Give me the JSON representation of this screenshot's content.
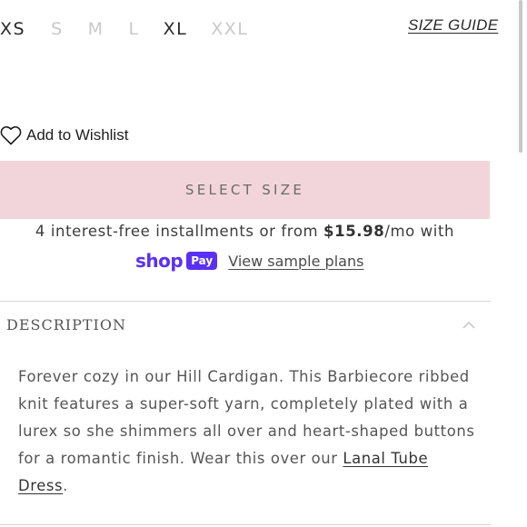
{
  "sizes": [
    {
      "label": "XS",
      "available": true
    },
    {
      "label": "S",
      "available": false
    },
    {
      "label": "M",
      "available": false
    },
    {
      "label": "L",
      "available": false
    },
    {
      "label": "XL",
      "available": true
    },
    {
      "label": "XXL",
      "available": false
    }
  ],
  "size_guide_label": "SIZE GUIDE",
  "wishlist": {
    "label": "Add to Wishlist",
    "icon": "heart-outline-icon"
  },
  "select_size_button": "SELECT SIZE",
  "installments": {
    "prefix": "4 interest-free installments or from ",
    "price": "$15.98",
    "suffix": "/mo with",
    "shop_word": "shop",
    "pay_badge": "Pay",
    "link": "View sample plans"
  },
  "description": {
    "title": "DESCRIPTION",
    "expanded": true,
    "text": "Forever cozy in our Hill Cardigan. This Barbiecore ribbed knit features a super-soft yarn, completely plated with a lurex so she shimmers all over and heart-shaped buttons for a romantic finish. Wear this over our ",
    "link": "Lanal Tube Dress",
    "end": "."
  },
  "colors": {
    "button_bg": "#f2d5da",
    "shop_pay_purple": "#5a31f4",
    "unavailable_size": "#c9c9c9"
  }
}
